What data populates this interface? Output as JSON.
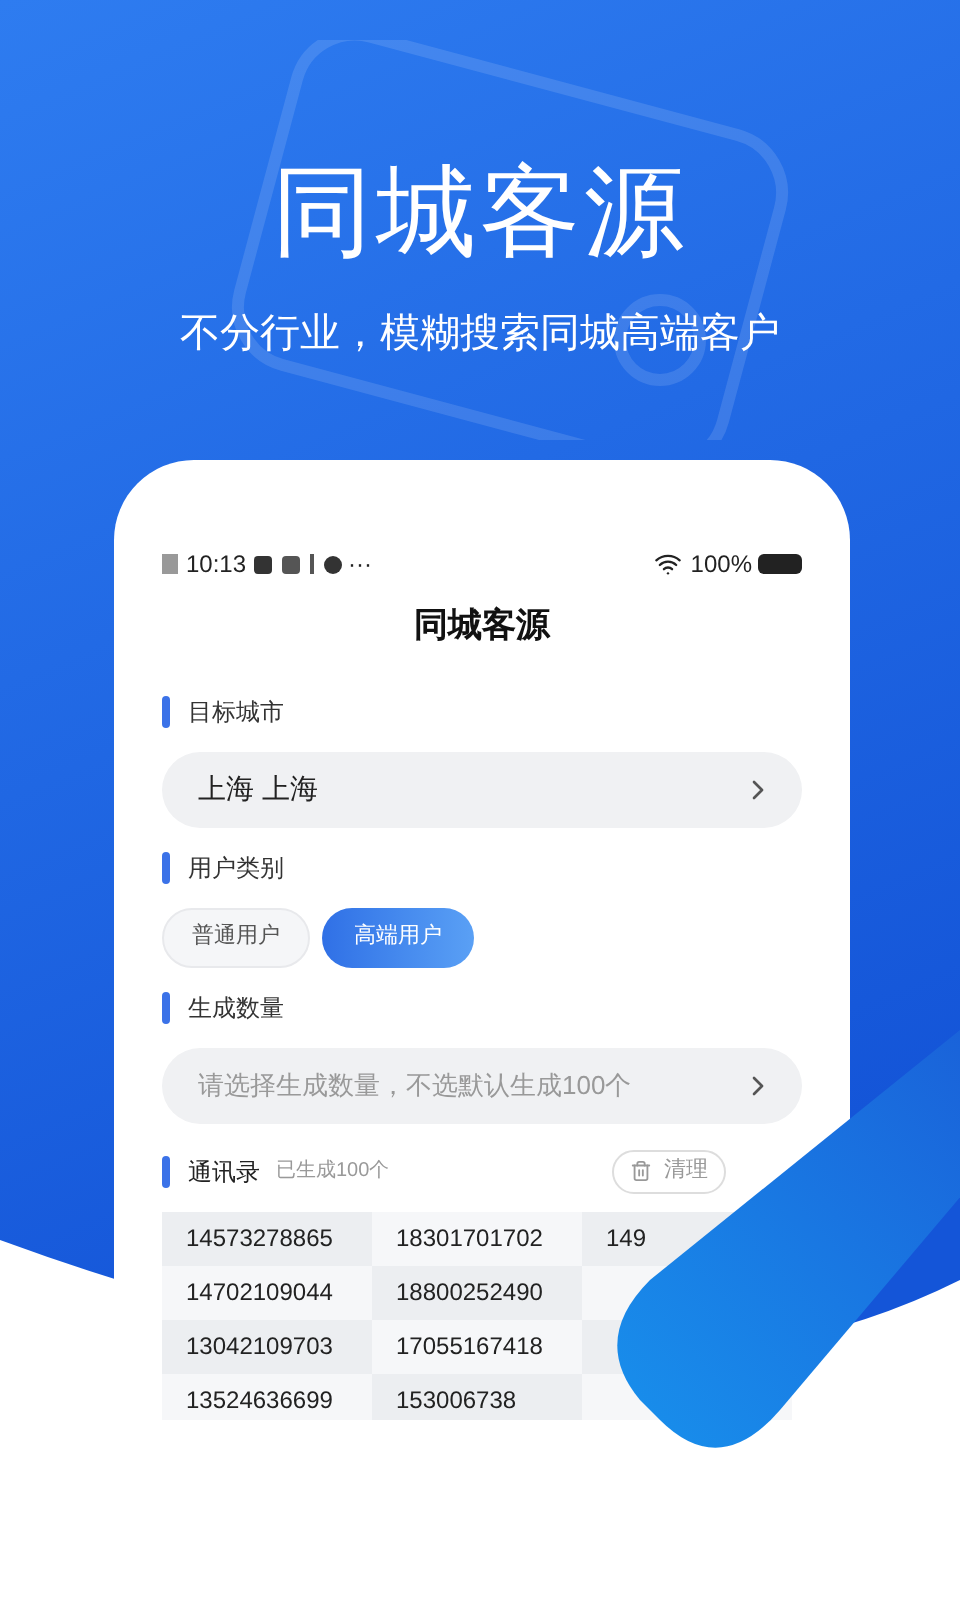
{
  "hero": {
    "title": "同城客源",
    "subtitle": "不分行业，模糊搜索同城高端客户"
  },
  "status_bar": {
    "time": "10:13",
    "more": "···",
    "battery": "100%"
  },
  "screen_title": "同城客源",
  "sections": [
    {
      "label": "目标城市",
      "kind": "select",
      "value": "上海 上海"
    },
    {
      "label": "用户类别",
      "kind": "chips",
      "options": [
        {
          "label": "普通用户",
          "selected": false
        },
        {
          "label": "高端用户",
          "selected": true
        }
      ]
    },
    {
      "label": "生成数量",
      "kind": "select",
      "placeholder": "请选择生成数量，不选默认生成100个"
    }
  ],
  "contacts": {
    "label": "通讯录",
    "count": "已生成100个",
    "clear_button": "清理",
    "rows": [
      [
        "14573278865",
        "18301701702",
        "149"
      ],
      [
        "14702109044",
        "18800252490"
      ],
      [
        "13042109703",
        "17055167418"
      ],
      [
        "13524636699",
        "153006738"
      ]
    ]
  }
}
